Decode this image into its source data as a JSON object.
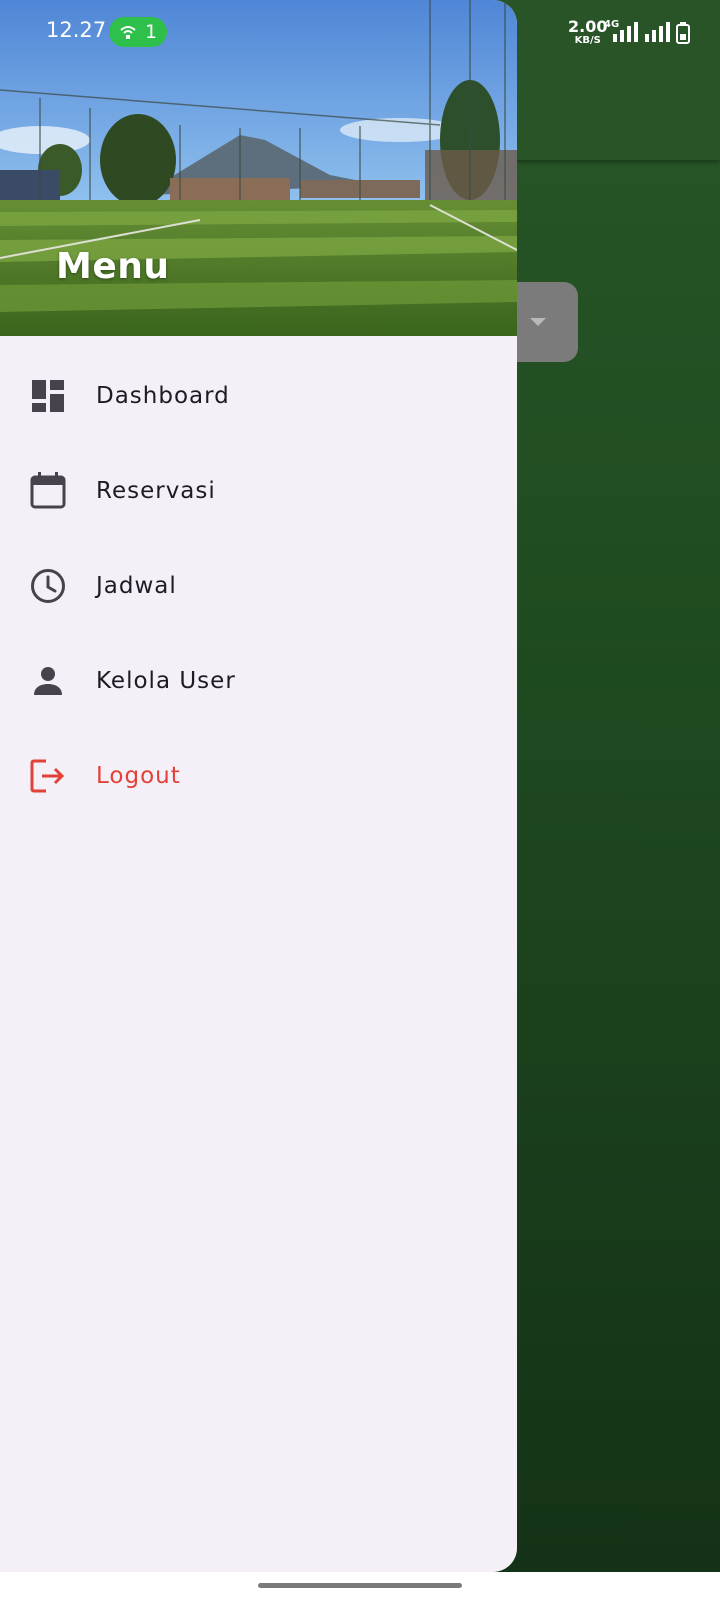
{
  "status_bar": {
    "time": "12.27",
    "hotspot_count": "1",
    "net_speed": "2.00",
    "net_speed_unit": "KB/S",
    "network_type": "4G"
  },
  "drawer": {
    "title": "Menu",
    "items": [
      {
        "label": "Dashboard",
        "icon": "dashboard-icon"
      },
      {
        "label": "Reservasi",
        "icon": "calendar-icon"
      },
      {
        "label": "Jadwal",
        "icon": "clock-icon"
      },
      {
        "label": "Kelola User",
        "icon": "person-icon"
      },
      {
        "label": "Logout",
        "icon": "logout-icon",
        "color": "#e0423a"
      }
    ]
  },
  "colors": {
    "app_bar": "#295428",
    "drawer_bg": "#f5f0f8",
    "hotspot": "#2fbf4b",
    "logout": "#e0423a"
  }
}
